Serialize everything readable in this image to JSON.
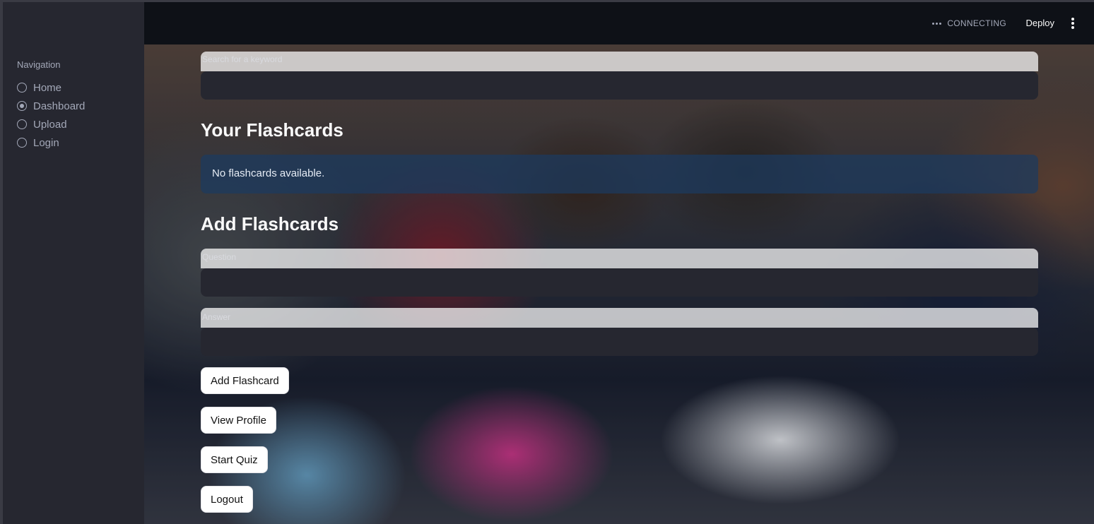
{
  "sidebar": {
    "title": "Navigation",
    "items": [
      {
        "label": "Home",
        "selected": false
      },
      {
        "label": "Dashboard",
        "selected": true
      },
      {
        "label": "Upload",
        "selected": false
      },
      {
        "label": "Login",
        "selected": false
      }
    ]
  },
  "topbar": {
    "status": "CONNECTING",
    "deploy_label": "Deploy",
    "menu_icon": "vertical-ellipsis-icon"
  },
  "search": {
    "label": "Search for a keyword",
    "value": ""
  },
  "flashcards": {
    "heading": "Your Flashcards",
    "empty_message": "No flashcards available."
  },
  "add_form": {
    "heading": "Add Flashcards",
    "question_label": "Question",
    "question_value": "",
    "answer_label": "Answer",
    "answer_value": ""
  },
  "buttons": {
    "add_flashcard": "Add Flashcard",
    "view_profile": "View Profile",
    "start_quiz": "Start Quiz",
    "logout": "Logout"
  },
  "colors": {
    "sidebar_bg": "#262730",
    "app_bg": "#0e1117",
    "input_bg": "#262730",
    "info_bg": "#1c3a60"
  }
}
